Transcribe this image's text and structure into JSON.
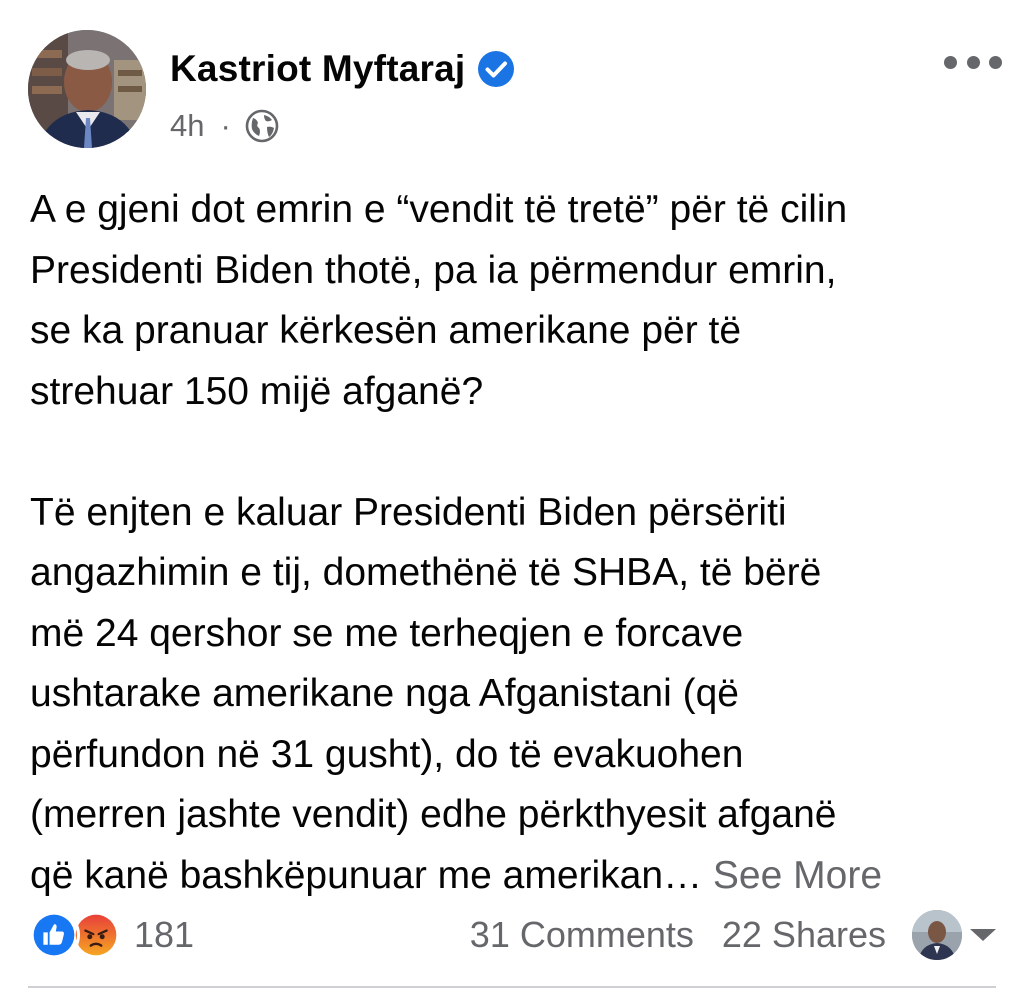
{
  "post": {
    "author": "Kastriot Myftaraj",
    "verified": true,
    "time": "4h",
    "separator": "·",
    "audience_icon": "globe-icon",
    "more_icon": "more-options-icon",
    "paragraph1": [
      "A e gjeni dot emrin e “vendit të tretë” për të cilin",
      "Presidenti Biden thotë, pa ia përmendur emrin,",
      "se ka pranuar kërkesën amerikane për të",
      "strehuar 150 mijë afganë?"
    ],
    "paragraph2": [
      "Të enjten e kaluar Presidenti Biden përsëriti",
      "angazhimin e tij, domethënë të SHBA, të bërë",
      "më 24 qershor se me terheqjen e forcave",
      "ushtarake amerikane nga Afganistani (që",
      "përfundon në 31 gusht), do  të evakuohen",
      "(merren jashte vendit) edhe përkthyesit afganë",
      "që kanë bashkëpunuar me amerikan…"
    ],
    "see_more": "See More"
  },
  "footer": {
    "reactions": [
      "like",
      "angry"
    ],
    "reaction_count": "181",
    "comments": "31 Comments",
    "shares": "22 Shares"
  },
  "colors": {
    "text": "#050505",
    "secondary": "#65676b",
    "verified_blue": "#1b74e4",
    "like_blue": "#1877f2",
    "angry_orange": "#f0642b",
    "divider": "#ced0d4"
  }
}
